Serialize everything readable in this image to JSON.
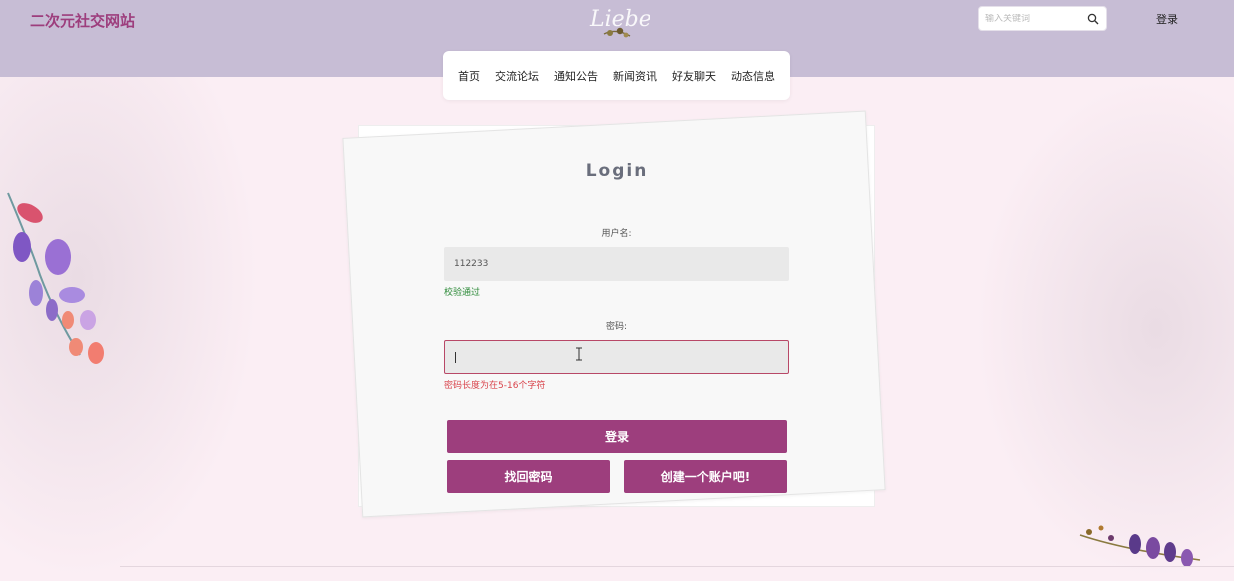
{
  "header": {
    "site_title": "二次元社交网站",
    "search_placeholder": "输入关键词",
    "login_link": "登录"
  },
  "nav": {
    "items": [
      {
        "label": "首页"
      },
      {
        "label": "交流论坛"
      },
      {
        "label": "通知公告"
      },
      {
        "label": "新闻资讯"
      },
      {
        "label": "好友聊天"
      },
      {
        "label": "动态信息"
      }
    ]
  },
  "login_form": {
    "title": "Login",
    "username_label": "用户名:",
    "username_value": "112233",
    "username_hint": "校验通过",
    "password_label": "密码:",
    "password_value": "",
    "password_hint": "密码长度为在5-16个字符",
    "submit_label": "登录",
    "forgot_label": "找回密码",
    "register_label": "创建一个账户吧!"
  },
  "colors": {
    "brand": "#9d3e7d",
    "header_bg": "#c7bdd5",
    "page_bg": "#fbeef4",
    "success": "#2e8b3a",
    "error": "#d9434b"
  },
  "icons": [
    "search-icon",
    "text-cursor-icon",
    "logo-mark"
  ]
}
